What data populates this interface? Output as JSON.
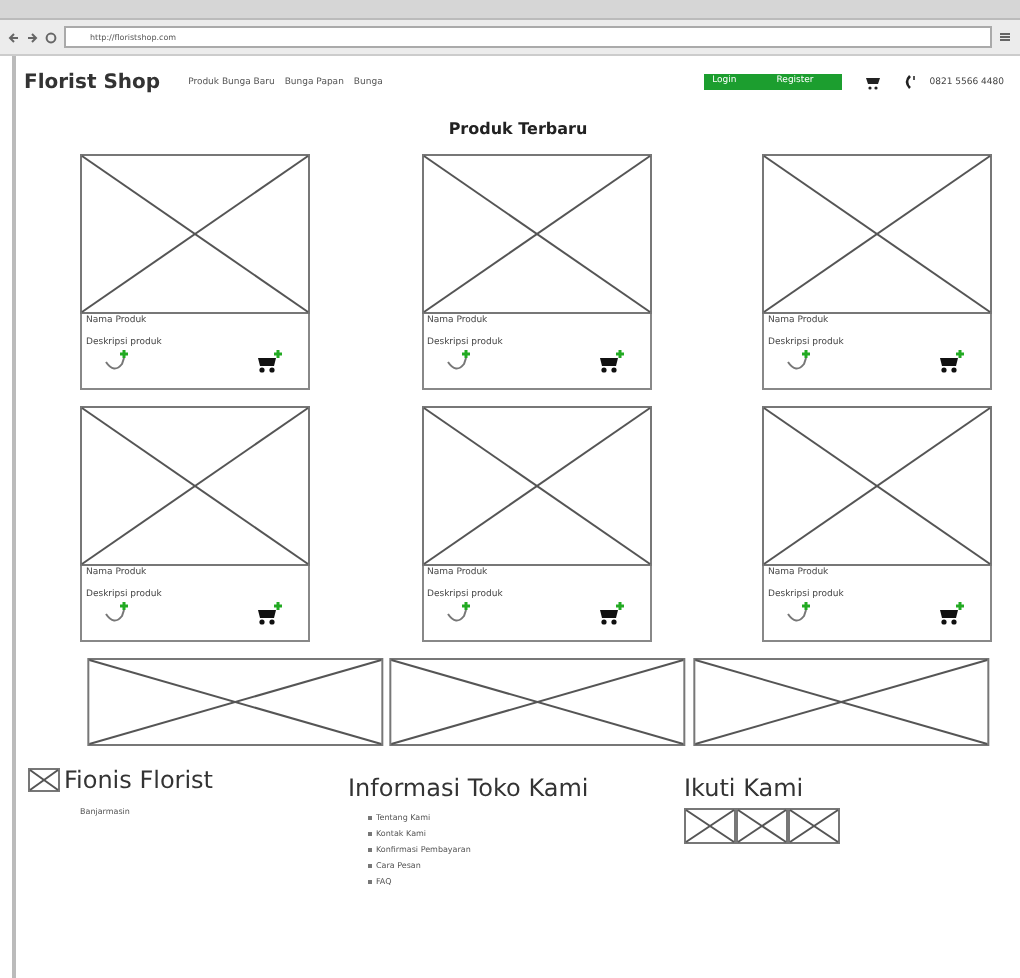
{
  "browser": {
    "address": "http://floristshop.com"
  },
  "navbar": {
    "brand": "Florist Shop",
    "links": [
      "Produk Bunga Baru",
      "Bunga Papan",
      "Bunga"
    ],
    "login": "Login",
    "register": "Register",
    "phone": "0821 5566 4480"
  },
  "section_title": "Produk Terbaru",
  "products": [
    {
      "name": "Nama Produk",
      "description": "Deskripsi produk"
    },
    {
      "name": "Nama Produk",
      "description": "Deskripsi produk"
    },
    {
      "name": "Nama Produk",
      "description": "Deskripsi produk"
    },
    {
      "name": "Nama Produk",
      "description": "Deskripsi produk"
    },
    {
      "name": "Nama Produk",
      "description": "Deskripsi produk"
    },
    {
      "name": "Nama Produk",
      "description": "Deskripsi produk"
    }
  ],
  "footer": {
    "brand": "Fionis Florist",
    "city": "Banjarmasin",
    "info_title": "Informasi Toko Kami",
    "info_links": [
      "Tentang Kami",
      "Kontak Kami",
      "Konfirmasi Pembayaran",
      "Cara Pesan",
      "FAQ"
    ],
    "follow_title": "Ikuti Kami"
  }
}
